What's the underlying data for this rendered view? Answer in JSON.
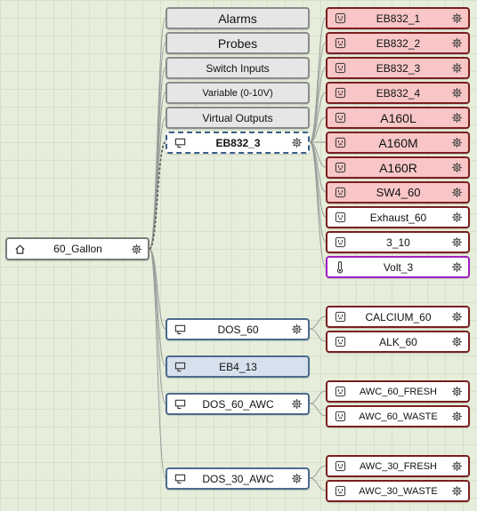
{
  "root": {
    "label": "60_Gallon"
  },
  "categories": [
    {
      "label": "Alarms"
    },
    {
      "label": "Probes"
    },
    {
      "label": "Switch Inputs"
    },
    {
      "label": "Variable (0-10V)"
    },
    {
      "label": "Virtual Outputs"
    }
  ],
  "devices": [
    {
      "label": "EB832_3"
    },
    {
      "label": "DOS_60"
    },
    {
      "label": "EB4_13"
    },
    {
      "label": "DOS_60_AWC"
    },
    {
      "label": "DOS_30_AWC"
    }
  ],
  "eb832_outputs": [
    {
      "label": "EB832_1",
      "state": "on"
    },
    {
      "label": "EB832_2",
      "state": "on"
    },
    {
      "label": "EB832_3",
      "state": "on"
    },
    {
      "label": "EB832_4",
      "state": "on"
    },
    {
      "label": "A160L",
      "state": "on"
    },
    {
      "label": "A160M",
      "state": "on"
    },
    {
      "label": "A160R",
      "state": "on"
    },
    {
      "label": "SW4_60",
      "state": "on"
    },
    {
      "label": "Exhaust_60",
      "state": "off"
    },
    {
      "label": "3_10",
      "state": "off"
    },
    {
      "label": "Volt_3",
      "state": "probe"
    }
  ],
  "dos60_outputs": [
    {
      "label": "CALCIUM_60"
    },
    {
      "label": "ALK_60"
    }
  ],
  "dos60awc_outputs": [
    {
      "label": "AWC_60_FRESH"
    },
    {
      "label": "AWC_60_WASTE"
    }
  ],
  "dos30awc_outputs": [
    {
      "label": "AWC_30_FRESH"
    },
    {
      "label": "AWC_30_WASTE"
    }
  ],
  "colors": {
    "output_on_fill": "#f8c6c6",
    "output_border": "#7a1f1f",
    "device_border": "#4a6a8f",
    "device_highlight_fill": "#d7e1ee",
    "probe_border": "#a020c0",
    "wire": "#9a9a9a"
  },
  "icons": {
    "root": "home-icon",
    "device": "monitor-icon",
    "output": "outlet-icon",
    "probe": "thermometer-icon",
    "settings": "gear-icon"
  }
}
